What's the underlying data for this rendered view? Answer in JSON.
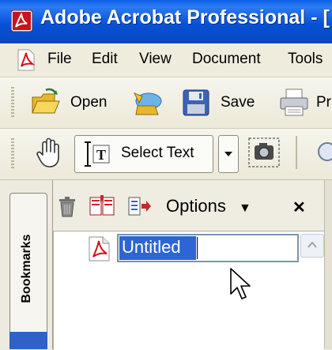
{
  "title_bar": {
    "app_title": "Adobe Acrobat Professional - ["
  },
  "menu": {
    "items": [
      "File",
      "Edit",
      "View",
      "Document",
      "Tools"
    ]
  },
  "toolbar_file": {
    "open_label": "Open",
    "save_label": "Save",
    "print_label": "Pr"
  },
  "toolbar_select": {
    "select_text_label": "Select Text"
  },
  "nav_tabs": {
    "bookmarks_label": "Bookmarks"
  },
  "bookmarks_panel": {
    "options_label": "Options",
    "options_arrow": "▼",
    "close_glyph": "✕",
    "editing_bookmark_text": "Untitled"
  },
  "colors": {
    "titlebar_blue": "#0A5EE8",
    "selection_blue": "#2E65D2",
    "chrome_beige": "#ECE9D8"
  }
}
